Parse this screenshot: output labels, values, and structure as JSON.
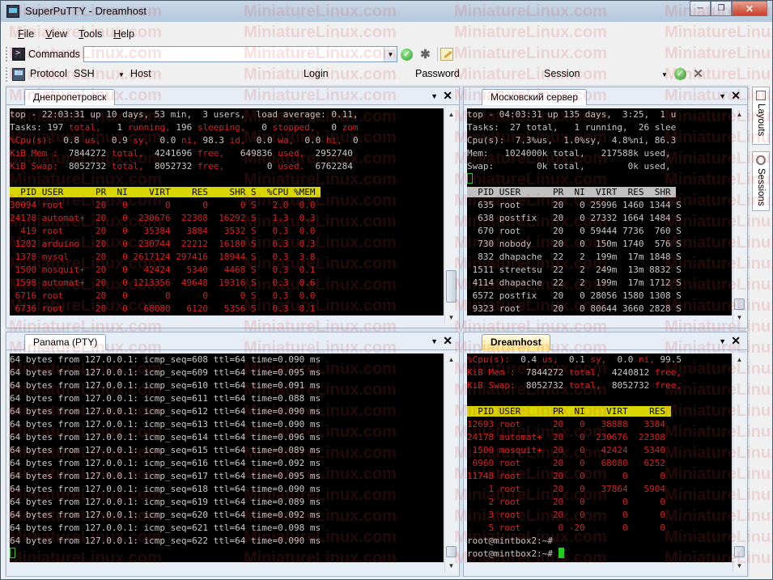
{
  "window": {
    "title": "SuperPuTTY - Dreamhost"
  },
  "menu": [
    {
      "label": "File",
      "accel": "F",
      "rest": "ile"
    },
    {
      "label": "View",
      "accel": "V",
      "rest": "iew"
    },
    {
      "label": "Tools",
      "accel": "T",
      "rest": "ools"
    },
    {
      "label": "Help",
      "accel": "H",
      "rest": "elp"
    }
  ],
  "commands": {
    "label": "Commands",
    "value": ""
  },
  "connect": {
    "protocol_label": "Protocol",
    "protocol_value": "SSH",
    "host_label": "Host",
    "login_label": "Login",
    "password_label": "Password",
    "session_label": "Session"
  },
  "side_tabs": [
    "Layouts",
    "Sessions"
  ],
  "watermark": "MiniatureLinux.com",
  "panels": {
    "p1": {
      "tab": "Днепропетровск",
      "lines": [
        [
          {
            "t": "top - 22:03:31 up 10 days, 53 min,  3 users,  load average: 0.11,"
          }
        ],
        [
          {
            "t": "Tasks: "
          },
          {
            "t": "197",
            "c": ""
          },
          {
            "t": " total,",
            "c": "red"
          },
          {
            "t": "   1 "
          },
          {
            "t": "running,",
            "c": "red"
          },
          {
            "t": " 196 "
          },
          {
            "t": "sleeping,",
            "c": "red"
          },
          {
            "t": "   0 "
          },
          {
            "t": "stopped,",
            "c": "red"
          },
          {
            "t": "   0 "
          },
          {
            "t": "zom",
            "c": "red"
          }
        ],
        [
          {
            "t": "%Cpu(s):",
            "c": "red"
          },
          {
            "t": "  0.8 "
          },
          {
            "t": "us,",
            "c": "red"
          },
          {
            "t": "  0.9 "
          },
          {
            "t": "sy,",
            "c": "red"
          },
          {
            "t": "  0.0 "
          },
          {
            "t": "ni,",
            "c": "red"
          },
          {
            "t": " 98.3 "
          },
          {
            "t": "id,",
            "c": "red"
          },
          {
            "t": "  0.0 "
          },
          {
            "t": "wa,",
            "c": "red"
          },
          {
            "t": "  0.0 "
          },
          {
            "t": "hi,",
            "c": "red"
          },
          {
            "t": "  0"
          }
        ],
        [
          {
            "t": "KiB Mem :",
            "c": "red"
          },
          {
            "t": "  7844272 "
          },
          {
            "t": "total,",
            "c": "red"
          },
          {
            "t": "  4241696 "
          },
          {
            "t": "free,",
            "c": "red"
          },
          {
            "t": "   649836 "
          },
          {
            "t": "used,",
            "c": "red"
          },
          {
            "t": "  2952740"
          }
        ],
        [
          {
            "t": "KiB Swap:",
            "c": "red"
          },
          {
            "t": "  8052732 "
          },
          {
            "t": "total,",
            "c": "red"
          },
          {
            "t": "  8052732 "
          },
          {
            "t": "free,",
            "c": "red"
          },
          {
            "t": "        0 "
          },
          {
            "t": "used.",
            "c": "red"
          },
          {
            "t": "  6762284"
          }
        ],
        [
          {
            "t": ""
          }
        ],
        [
          {
            "t": "  PID USER      PR  NI    VIRT    RES    SHR S  %CPU %MEM ",
            "c": "yel-bar"
          }
        ],
        [
          {
            "t": "30094 root      20   0       0      0      0 S   2.0  0.0",
            "c": "red"
          }
        ],
        [
          {
            "t": "24178 automat+  20   0  230676  22308  16292 S   1.3  0.3",
            "c": "red"
          }
        ],
        [
          {
            "t": "  419 root      20   0   35384   3884   3532 S   0.3  0.0",
            "c": "red"
          }
        ],
        [
          {
            "t": " 1202 arduino   20   0  230744  22212  16180 S   0.3  0.3",
            "c": "red"
          }
        ],
        [
          {
            "t": " 1378 mysql     20   0 2617124 297416  18944 S   0.3  3.8",
            "c": "red"
          }
        ],
        [
          {
            "t": " 1500 mosquit+  20   0   42424   5340   4468 S   0.3  0.1",
            "c": "red"
          }
        ],
        [
          {
            "t": " 1598 automat+  20   0 1213356  49648  19316 S   0.3  0.6",
            "c": "red"
          }
        ],
        [
          {
            "t": " 6716 root      20   0       0      0      0 S   0.3  0.0",
            "c": "red"
          }
        ],
        [
          {
            "t": " 6736 root      20   0   68080   6120   5356 S   0.3  0.1",
            "c": "red"
          }
        ]
      ]
    },
    "p2": {
      "tab": "Московский сервер",
      "lines": [
        [
          {
            "t": "top - 04:03:31 up 135 days,  3:25,  1 u"
          }
        ],
        [
          {
            "t": "Tasks:  27 total,   1 running,  26 slee"
          }
        ],
        [
          {
            "t": "Cpu(s):  7.3%us,  1.0%sy,  4.8%ni, 86.3"
          }
        ],
        [
          {
            "t": "Mem:   1024000k total,   217588k used,"
          }
        ],
        [
          {
            "t": "Swap:        0k total,        0k used,"
          }
        ],
        [
          {
            "cursor": "hollow"
          }
        ],
        [
          {
            "t": "  PID USER      PR  NI  VIRT  RES  SHR ",
            "c": "gray-bar"
          }
        ],
        [
          {
            "t": "  635 root      20   0 25996 1460 1344 S"
          }
        ],
        [
          {
            "t": "  638 postfix   20   0 27332 1664 1484 S"
          }
        ],
        [
          {
            "t": "  670 root      20   0 59444 7736  760 S"
          }
        ],
        [
          {
            "t": "  730 nobody    20   0  150m 1740  576 S"
          }
        ],
        [
          {
            "t": "  832 dhapache  22   2  199m  17m 1848 S"
          }
        ],
        [
          {
            "t": " 1511 streetsu  22   2  249m  13m 8832 S"
          }
        ],
        [
          {
            "t": " 4114 dhapache  22   2  199m  17m 1712 S"
          }
        ],
        [
          {
            "t": " 6572 postfix   20   0 28056 1580 1308 S"
          }
        ],
        [
          {
            "t": " 9323 root      20   0 80644 3660 2828 S"
          }
        ]
      ]
    },
    "p3": {
      "tab": "Panama (PTY)",
      "lines": [
        [
          {
            "t": "64 bytes from 127.0.0.1: icmp_seq=608 ttl=64 time=0.090 ms"
          }
        ],
        [
          {
            "t": "64 bytes from 127.0.0.1: icmp_seq=609 ttl=64 time=0.095 ms"
          }
        ],
        [
          {
            "t": "64 bytes from 127.0.0.1: icmp_seq=610 ttl=64 time=0.091 ms"
          }
        ],
        [
          {
            "t": "64 bytes from 127.0.0.1: icmp_seq=611 ttl=64 time=0.088 ms"
          }
        ],
        [
          {
            "t": "64 bytes from 127.0.0.1: icmp_seq=612 ttl=64 time=0.090 ms"
          }
        ],
        [
          {
            "t": "64 bytes from 127.0.0.1: icmp_seq=613 ttl=64 time=0.090 ms"
          }
        ],
        [
          {
            "t": "64 bytes from 127.0.0.1: icmp_seq=614 ttl=64 time=0.096 ms"
          }
        ],
        [
          {
            "t": "64 bytes from 127.0.0.1: icmp_seq=615 ttl=64 time=0.089 ms"
          }
        ],
        [
          {
            "t": "64 bytes from 127.0.0.1: icmp_seq=616 ttl=64 time=0.092 ms"
          }
        ],
        [
          {
            "t": "64 bytes from 127.0.0.1: icmp_seq=617 ttl=64 time=0.095 ms"
          }
        ],
        [
          {
            "t": "64 bytes from 127.0.0.1: icmp_seq=618 ttl=64 time=0.090 ms"
          }
        ],
        [
          {
            "t": "64 bytes from 127.0.0.1: icmp_seq=619 ttl=64 time=0.089 ms"
          }
        ],
        [
          {
            "t": "64 bytes from 127.0.0.1: icmp_seq=620 ttl=64 time=0.092 ms"
          }
        ],
        [
          {
            "t": "64 bytes from 127.0.0.1: icmp_seq=621 ttl=64 time=0.098 ms"
          }
        ],
        [
          {
            "t": "64 bytes from 127.0.0.1: icmp_seq=622 ttl=64 time=0.090 ms"
          }
        ],
        [
          {
            "cursor": "hollow"
          }
        ]
      ]
    },
    "p4": {
      "tab": "Dreamhost",
      "lines": [
        [
          {
            "t": "%Cpu(s):",
            "c": "red"
          },
          {
            "t": "  0.4 "
          },
          {
            "t": "us,",
            "c": "red"
          },
          {
            "t": "  0.1 "
          },
          {
            "t": "sy,",
            "c": "red"
          },
          {
            "t": "  0.0 "
          },
          {
            "t": "ni,",
            "c": "red"
          },
          {
            "t": " 99.5"
          }
        ],
        [
          {
            "t": "KiB Mem :",
            "c": "red"
          },
          {
            "t": "  7844272 "
          },
          {
            "t": "total,",
            "c": "red"
          },
          {
            "t": "  4240812 "
          },
          {
            "t": "free,",
            "c": "red"
          }
        ],
        [
          {
            "t": "KiB Swap:",
            "c": "red"
          },
          {
            "t": "  8052732 "
          },
          {
            "t": "total,",
            "c": "red"
          },
          {
            "t": "  8052732 "
          },
          {
            "t": "free,",
            "c": "red"
          }
        ],
        [
          {
            "t": ""
          }
        ],
        [
          {
            "t": "  PID USER      PR  NI    VIRT    RES ",
            "c": "yel-bar"
          }
        ],
        [
          {
            "t": "12693 root      20   0   38888   3384",
            "c": "red"
          }
        ],
        [
          {
            "t": "24178 automat+  20   0  230676  22308",
            "c": "red"
          }
        ],
        [
          {
            "t": " 1500 mosquit+  20   0   42424   5340",
            "c": "red"
          }
        ],
        [
          {
            "t": " 6960 root      20   0   68080   6252",
            "c": "red"
          }
        ],
        [
          {
            "t": "11748 root      20   0       0      0",
            "c": "red"
          }
        ],
        [
          {
            "t": "    1 root      20   0   37864   5904",
            "c": "red"
          }
        ],
        [
          {
            "t": "    2 root      20   0       0      0",
            "c": "red"
          }
        ],
        [
          {
            "t": "    3 root      20   0       0      0",
            "c": "red"
          }
        ],
        [
          {
            "t": "    5 root       0 -20       0      0",
            "c": "red"
          }
        ],
        [
          {
            "t": "root@mintbox2:~#"
          }
        ],
        [
          {
            "t": "root@mintbox2:~# "
          },
          {
            "cursor": "solid"
          }
        ]
      ]
    }
  }
}
